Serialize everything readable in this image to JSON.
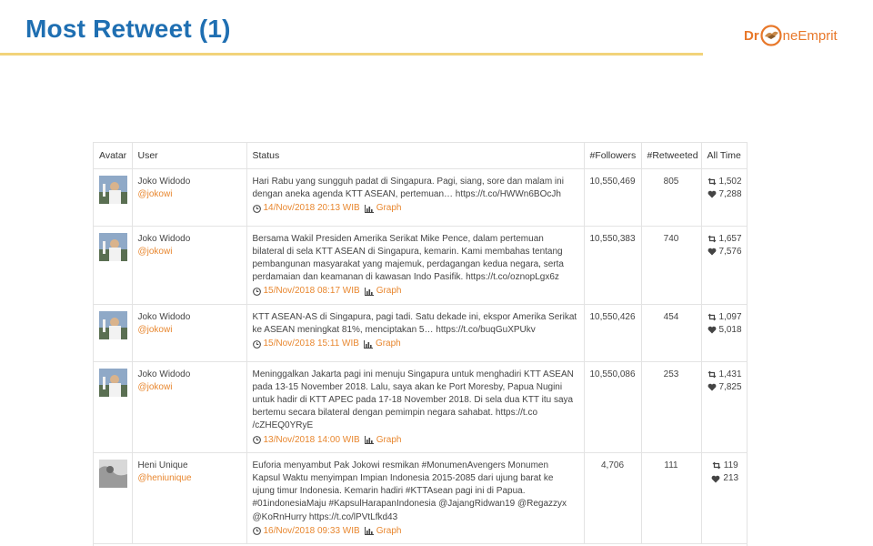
{
  "slide": {
    "title": "Most Retweet (1)",
    "logo": {
      "dr": "Dr",
      "ne": "ne",
      "emprit": "Emprit"
    },
    "accent_color": "#1f6fb2",
    "rule_color": "#f2d37a",
    "link_color": "#e8872f"
  },
  "table": {
    "headers": {
      "avatar": "Avatar",
      "user": "User",
      "status": "Status",
      "followers": "#Followers",
      "retweeted": "#Retweeted",
      "alltime": "All Time"
    },
    "graph_label": "Graph",
    "rows": [
      {
        "name": "Joko Widodo",
        "handle": "@jokowi",
        "status": "Hari Rabu yang sungguh padat di Singapura. Pagi, siang, sore dan malam ini dengan aneka agenda KTT ASEAN, pertemuan… https://t.co/HWWn6BOcJh",
        "time": "14/Nov/2018 20:13 WIB",
        "followers": "10,550,469",
        "retweeted": "805",
        "alltime_retweets": "1,502",
        "alltime_likes": "7,288"
      },
      {
        "name": "Joko Widodo",
        "handle": "@jokowi",
        "status": "Bersama Wakil Presiden Amerika Serikat Mike Pence, dalam pertemuan bilateral di sela KTT ASEAN di Singapura, kemarin. Kami membahas tentang pembangunan masyarakat yang majemuk, perdagangan kedua negara, serta perdamaian dan keamanan di kawasan Indo Pasifik. https://t.co/oznopLgx6z",
        "time": "15/Nov/2018 08:17 WIB",
        "followers": "10,550,383",
        "retweeted": "740",
        "alltime_retweets": "1,657",
        "alltime_likes": "7,576"
      },
      {
        "name": "Joko Widodo",
        "handle": "@jokowi",
        "status": "KTT ASEAN-AS di Singapura, pagi tadi. Satu dekade ini, ekspor Amerika Serikat ke ASEAN meningkat 81%, menciptakan 5… https://t.co/buqGuXPUkv",
        "time": "15/Nov/2018 15:11 WIB",
        "followers": "10,550,426",
        "retweeted": "454",
        "alltime_retweets": "1,097",
        "alltime_likes": "5,018"
      },
      {
        "name": "Joko Widodo",
        "handle": "@jokowi",
        "status": "Meninggalkan Jakarta pagi ini menuju Singapura untuk menghadiri KTT ASEAN pada 13-15 November 2018. Lalu, saya akan ke Port Moresby, Papua Nugini untuk hadir di KTT APEC pada 17-18 November 2018. Di sela dua KTT itu saya bertemu secara bilateral dengan pemimpin negara sahabat. https://t.co /cZHEQ0YRyE",
        "time": "13/Nov/2018 14:00 WIB",
        "followers": "10,550,086",
        "retweeted": "253",
        "alltime_retweets": "1,431",
        "alltime_likes": "7,825"
      },
      {
        "name": "Heni Unique",
        "handle": "@heniunique",
        "status": "Euforia menyambut Pak Jokowi resmikan #MonumenAvengers Monumen Kapsul Waktu menyimpan Impian Indonesia 2015-2085 dari ujung barat ke ujung timur Indonesia. Kemarin hadiri #KTTAsean pagi ini di Papua. #01indonesiaMaju #KapsulHarapanIndonesia @JajangRidwan19 @Regazzyx @KoRnHurry https://t.co/lPVtLfkd43",
        "time": "16/Nov/2018 09:33 WIB",
        "followers": "4,706",
        "retweeted": "111",
        "alltime_retweets": "119",
        "alltime_likes": "213"
      }
    ]
  }
}
